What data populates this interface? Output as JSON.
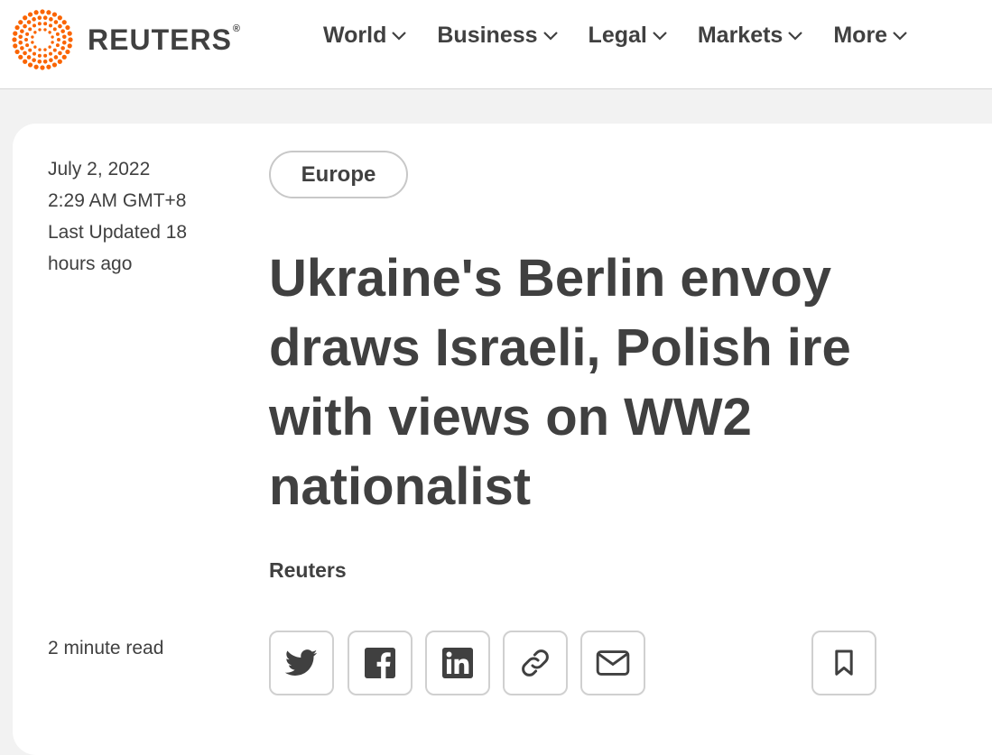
{
  "header": {
    "brand": "REUTERS",
    "brand_mark": "®",
    "nav": [
      {
        "label": "World"
      },
      {
        "label": "Business"
      },
      {
        "label": "Legal"
      },
      {
        "label": "Markets"
      },
      {
        "label": "More"
      }
    ]
  },
  "article": {
    "date": "July 2, 2022",
    "time": "2:29 AM GMT+8",
    "updated": "Last Updated 18 hours ago",
    "section": "Europe",
    "headline": "Ukraine's Berlin envoy draws Israeli, Polish ire with views on WW2 nationalist",
    "byline": "Reuters",
    "read_time": "2 minute read"
  },
  "share_icons": [
    "twitter-icon",
    "facebook-icon",
    "linkedin-icon",
    "link-icon",
    "email-icon",
    "bookmark-icon"
  ],
  "colors": {
    "brand_orange": "#fa6400",
    "text": "#404040",
    "background": "#f2f2f2"
  }
}
